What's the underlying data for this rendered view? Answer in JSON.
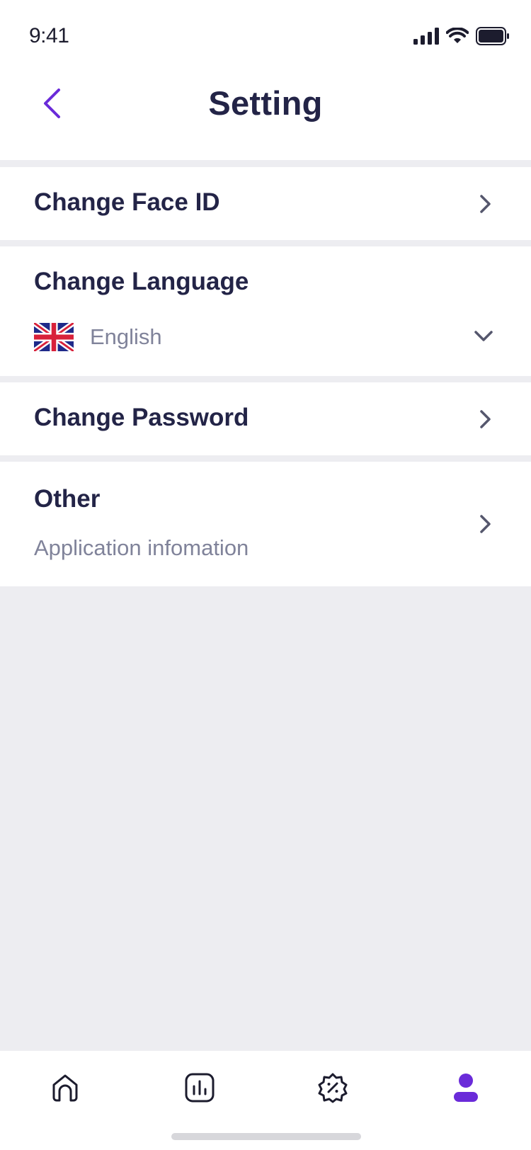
{
  "status_bar": {
    "time": "9:41"
  },
  "header": {
    "title": "Setting"
  },
  "settings": {
    "face_id": {
      "label": "Change Face ID"
    },
    "language": {
      "label": "Change Language",
      "value": "English"
    },
    "password": {
      "label": "Change Password"
    },
    "other": {
      "label": "Other",
      "subtitle": "Application infomation"
    }
  },
  "tabbar": {
    "tabs": [
      {
        "icon": "home-icon",
        "active": false
      },
      {
        "icon": "chart-icon",
        "active": false
      },
      {
        "icon": "discount-badge-icon",
        "active": false
      },
      {
        "icon": "profile-icon",
        "active": true
      }
    ]
  },
  "colors": {
    "accent": "#6a2bd9",
    "text_primary": "#232447",
    "text_secondary": "#80839a",
    "background": "#ededf1"
  }
}
